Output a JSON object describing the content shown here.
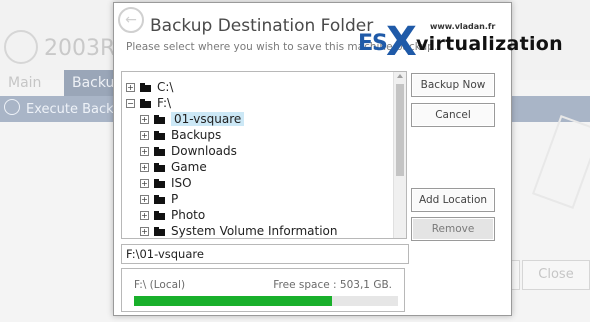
{
  "background": {
    "vm_name": "2003R2",
    "tabs": [
      "Main",
      "Backup"
    ],
    "execute_backup_label": "Execute Backup",
    "close_label": "Close"
  },
  "dialog": {
    "title": "Backup Destination Folder",
    "subtitle": "Please select where you wish to save this machine backup.",
    "tree": [
      {
        "label": "C:\\",
        "expander": "+",
        "level": 0
      },
      {
        "label": "F:\\",
        "expander": "−",
        "level": 0
      },
      {
        "label": "01-vsquare",
        "expander": "+",
        "level": 1,
        "selected": true
      },
      {
        "label": "Backups",
        "expander": "+",
        "level": 1
      },
      {
        "label": "Downloads",
        "expander": "+",
        "level": 1
      },
      {
        "label": "Game",
        "expander": "+",
        "level": 1
      },
      {
        "label": "ISO",
        "expander": "+",
        "level": 1
      },
      {
        "label": "P",
        "expander": "+",
        "level": 1
      },
      {
        "label": "Photo",
        "expander": "+",
        "level": 1
      },
      {
        "label": "System Volume Information",
        "expander": "+",
        "level": 1
      }
    ],
    "path_value": "F:\\01-vsquare",
    "disk": {
      "name": "F:\\ (Local)",
      "free_space": "Free space : 503,1 GB.",
      "used_fraction": 0.75
    },
    "buttons": {
      "backup_now": "Backup Now",
      "cancel": "Cancel",
      "add_location": "Add Location",
      "remove": "Remove"
    }
  },
  "watermark": {
    "url": "www.vladan.fr",
    "es": "ES",
    "x": "X",
    "virtualization": "virtualization"
  },
  "colors": {
    "progress_fill": "#19b02b",
    "selection": "#cce8f6",
    "brand_blue": "#1f5aa8"
  }
}
